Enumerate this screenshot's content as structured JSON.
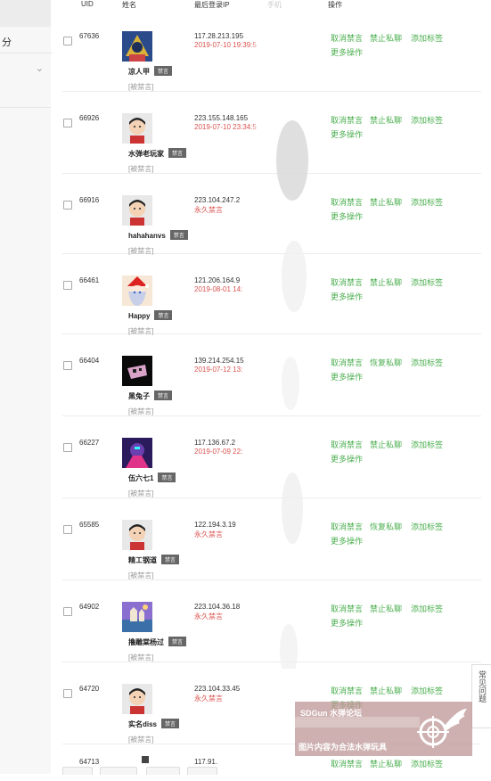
{
  "sidebar": {
    "item_label": "分",
    "arrow": "⌄"
  },
  "table": {
    "headers": {
      "uid": "UID",
      "name": "姓名",
      "ip": "最后登录IP",
      "ip_type": "手机",
      "actions": "操作"
    }
  },
  "rows": [
    {
      "uid": "67636",
      "name": "凉人甲",
      "badge": "禁言",
      "banned": "[被禁言]",
      "ip": "117.28.213.195",
      "date": "2019-07-10 19:39:5",
      "a1": "取消禁言",
      "a2": "禁止私聊",
      "a3": "添加标签",
      "more": "更多操作"
    },
    {
      "uid": "66926",
      "name": "水弹老玩家",
      "badge": "禁言",
      "banned": "[被禁言]",
      "ip": "223.155.148.165",
      "date": "2019-07-10 23:34:5",
      "a1": "取消禁言",
      "a2": "禁止私聊",
      "a3": "添加标签",
      "more": "更多操作"
    },
    {
      "uid": "66916",
      "name": "hahahanvs",
      "badge": "禁言",
      "banned": "[被禁言]",
      "ip": "223.104.247.2",
      "date": "永久禁言",
      "a1": "取消禁言",
      "a2": "禁止私聊",
      "a3": "添加标签",
      "more": "更多操作"
    },
    {
      "uid": "66461",
      "name": "Happy",
      "badge": "禁言",
      "banned": "[被禁言]",
      "ip": "121.206.164.9",
      "date": "2019-08-01 14:",
      "a1": "取消禁言",
      "a2": "禁止私聊",
      "a3": "添加标签",
      "more": "更多操作"
    },
    {
      "uid": "66404",
      "name": "黑兔子",
      "badge": "禁言",
      "banned": "[被禁言]",
      "ip": "139.214.254.15",
      "date": "2019-07-12 13:",
      "a1": "取消禁言",
      "a2": "恢复私聊",
      "a3": "添加标签",
      "more": "更多操作"
    },
    {
      "uid": "66227",
      "name": "伍六七1",
      "badge": "禁言",
      "banned": "[被禁言]",
      "ip": "117.136.67.2",
      "date": "2019-07-09 22:",
      "a1": "取消禁言",
      "a2": "禁止私聊",
      "a3": "添加标签",
      "more": "更多操作"
    },
    {
      "uid": "65585",
      "name": "精工钢道",
      "badge": "禁言",
      "banned": "[被禁言]",
      "ip": "122.194.3.19",
      "date": "永久禁言",
      "a1": "取消禁言",
      "a2": "恢复私聊",
      "a3": "添加标签",
      "more": "更多操作"
    },
    {
      "uid": "64902",
      "name": "撸雕棠杨过",
      "badge": "禁言",
      "banned": "[被禁言]",
      "ip": "223.104.36.18",
      "date": "永久禁言",
      "a1": "取消禁言",
      "a2": "禁止私聊",
      "a3": "添加标签",
      "more": "更多操作"
    },
    {
      "uid": "64720",
      "name": "实名diss",
      "badge": "禁言",
      "banned": "[被禁言]",
      "ip": "223.104.33.45",
      "date": "永久禁言",
      "a1": "取消禁言",
      "a2": "禁止私聊",
      "a3": "添加标签",
      "more": "更多操作"
    },
    {
      "uid": "64713",
      "name": "",
      "badge": "",
      "banned": "",
      "ip": "117.91.",
      "date": "",
      "a1": "取消禁言",
      "a2": "禁止私聊",
      "a3": "添加标签",
      "more": ""
    }
  ],
  "help": {
    "label": "常见问题"
  },
  "watermark": {
    "top": "SDGun 水弹论坛",
    "bottom": "图片内容为合法水弹玩具"
  },
  "colors": {
    "action": "#4caf50",
    "date": "#d9534f",
    "badge": "#666666"
  }
}
